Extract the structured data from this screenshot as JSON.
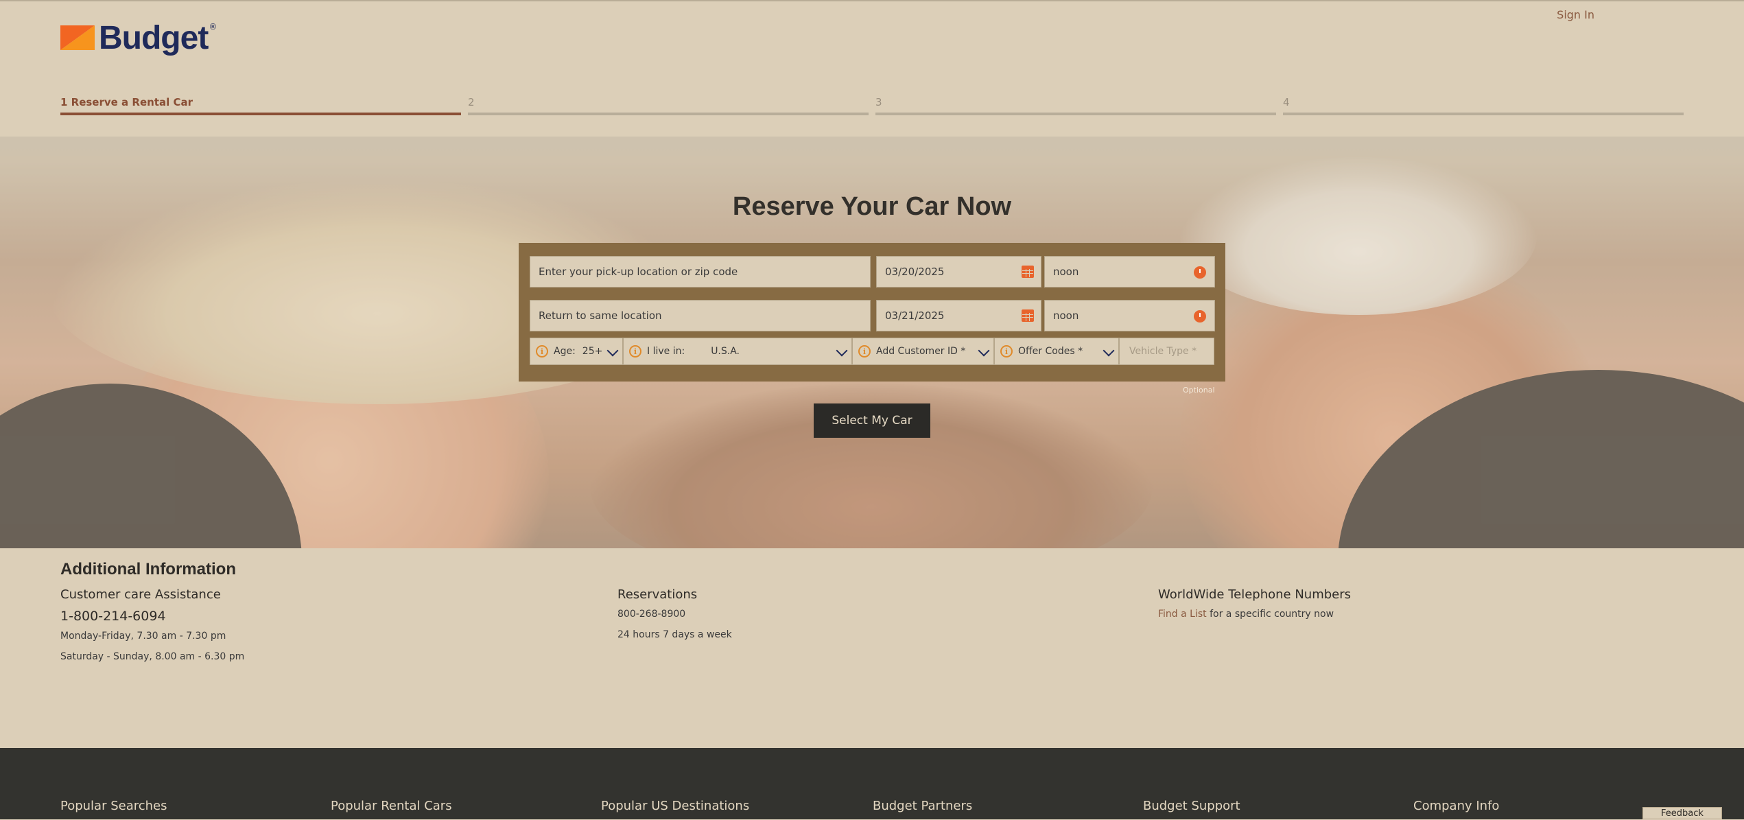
{
  "header": {
    "logo_text": "Budget",
    "logo_reg": "®",
    "sign_in": "Sign In"
  },
  "steps": [
    {
      "label": "1 Reserve a Rental Car",
      "active": true
    },
    {
      "label": "2",
      "active": false
    },
    {
      "label": "3",
      "active": false
    },
    {
      "label": "4",
      "active": false
    }
  ],
  "hero": {
    "title": "Reserve Your Car Now"
  },
  "form": {
    "pickup_location": {
      "placeholder": "Enter your pick-up location or zip code",
      "value": ""
    },
    "pickup_date": "03/20/2025",
    "pickup_time": "noon",
    "return_location": {
      "placeholder": "Return to same location",
      "value": ""
    },
    "return_date": "03/21/2025",
    "return_time": "noon",
    "age_label": "Age:",
    "age_value": "25+",
    "live_in_label": "I live in:",
    "live_in_value": "U.S.A.",
    "customer_id": "Add Customer ID *",
    "offer_codes": "Offer Codes *",
    "vehicle_type_placeholder": "Vehicle Type *",
    "optional_note": "Optional",
    "submit": "Select My Car",
    "info_glyph": "i"
  },
  "additional_info": {
    "title": "Additional Information",
    "customer_care": {
      "heading": "Customer care Assistance",
      "phone": "1-800-214-6094",
      "hours_weekday": "Monday-Friday, 7.30 am - 7.30 pm",
      "hours_weekend": "Saturday - Sunday, 8.00 am - 6.30 pm"
    },
    "reservations": {
      "heading": "Reservations",
      "phone": "800-268-8900",
      "hours": "24 hours 7 days a week"
    },
    "worldwide": {
      "heading": "WorldWide Telephone Numbers",
      "link": "Find a List",
      "text": " for a specific country now"
    }
  },
  "footer": {
    "columns": [
      "Popular Searches",
      "Popular Rental Cars",
      "Popular US Destinations",
      "Budget Partners",
      "Budget Support",
      "Company Info"
    ],
    "feedback": "Feedback"
  },
  "colors": {
    "background": "#dccfb8",
    "accent": "#e8642c",
    "active_step": "#8a4f35",
    "form_frame": "#876b43",
    "footer": "#33332f",
    "brand_navy": "#1f2a5a",
    "brand_orange": "#f26522"
  }
}
